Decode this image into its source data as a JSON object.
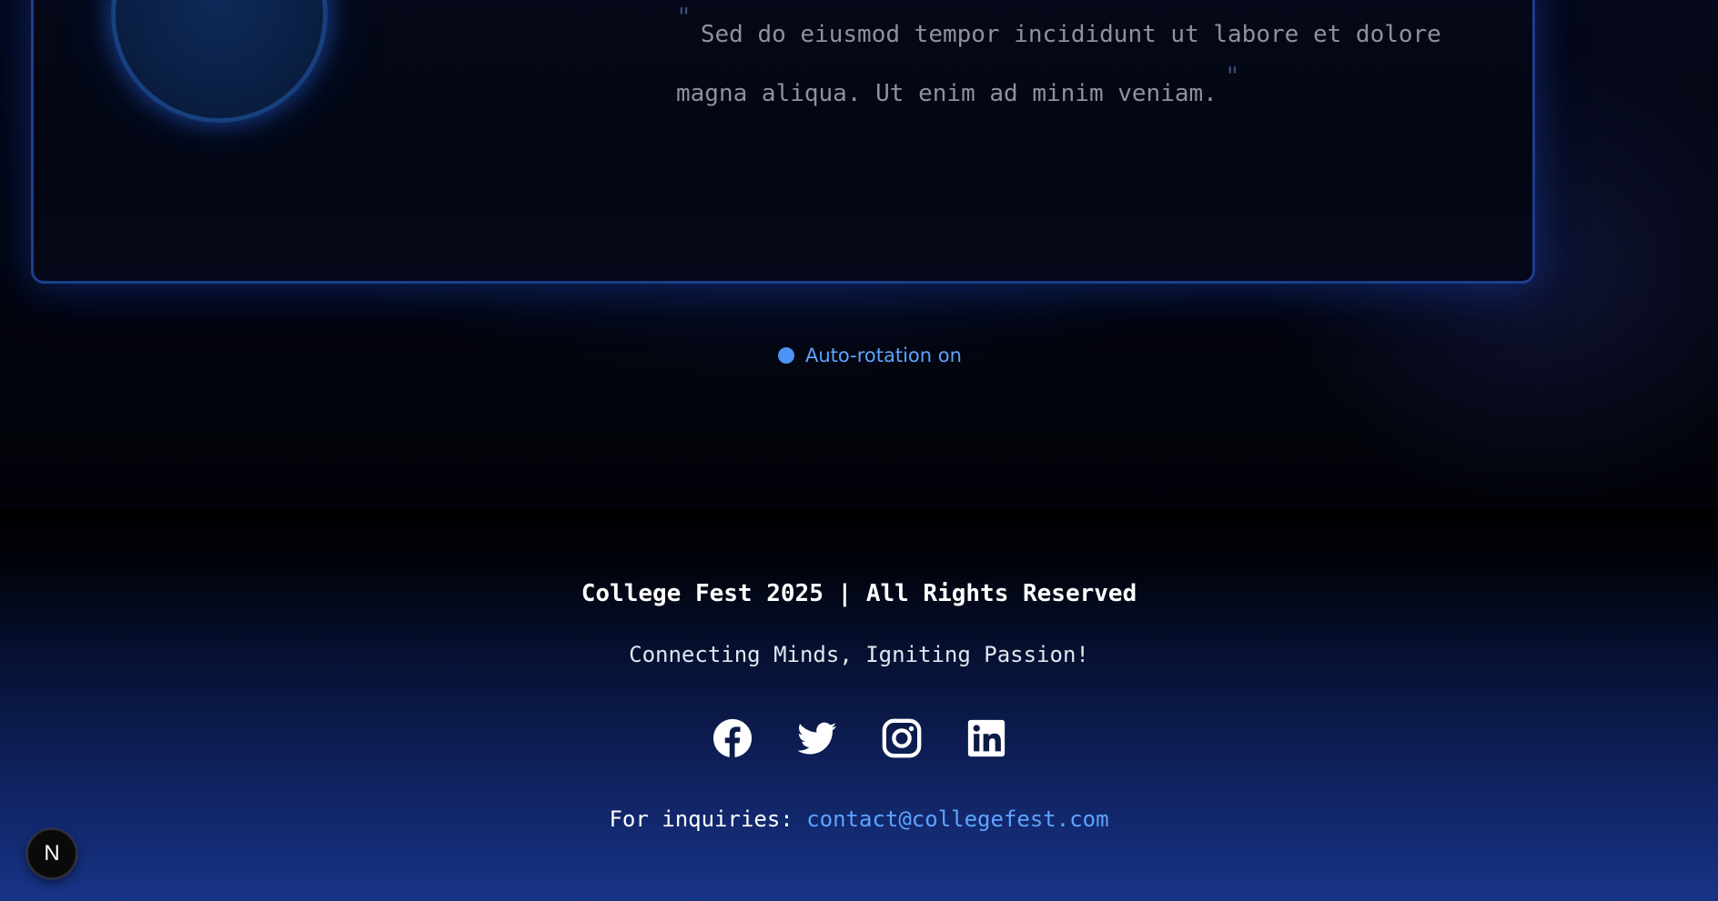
{
  "testimonial": {
    "partial_line": "— ——— —",
    "quote": "Sed do eiusmod tempor incididunt ut labore et dolore magna aliqua. Ut enim ad minim veniam.",
    "open_quote": "\"",
    "close_quote": "\""
  },
  "rotation": {
    "label": "Auto-rotation on",
    "dot_color": "#4d93f5"
  },
  "footer": {
    "title": "College Fest 2025 | All Rights Reserved",
    "tagline": "Connecting Minds, Igniting Passion!",
    "social": [
      {
        "name": "facebook-icon"
      },
      {
        "name": "twitter-icon"
      },
      {
        "name": "instagram-icon"
      },
      {
        "name": "linkedin-icon"
      }
    ],
    "contact_label": "For inquiries:",
    "contact_email": "contact@collegefest.com"
  },
  "badge": {
    "letter": "N",
    "icon": "nextjs-icon"
  },
  "colors": {
    "accent": "#5ea3ff",
    "card_border": "#1a3f8c",
    "footer_bottom": "#183487"
  }
}
